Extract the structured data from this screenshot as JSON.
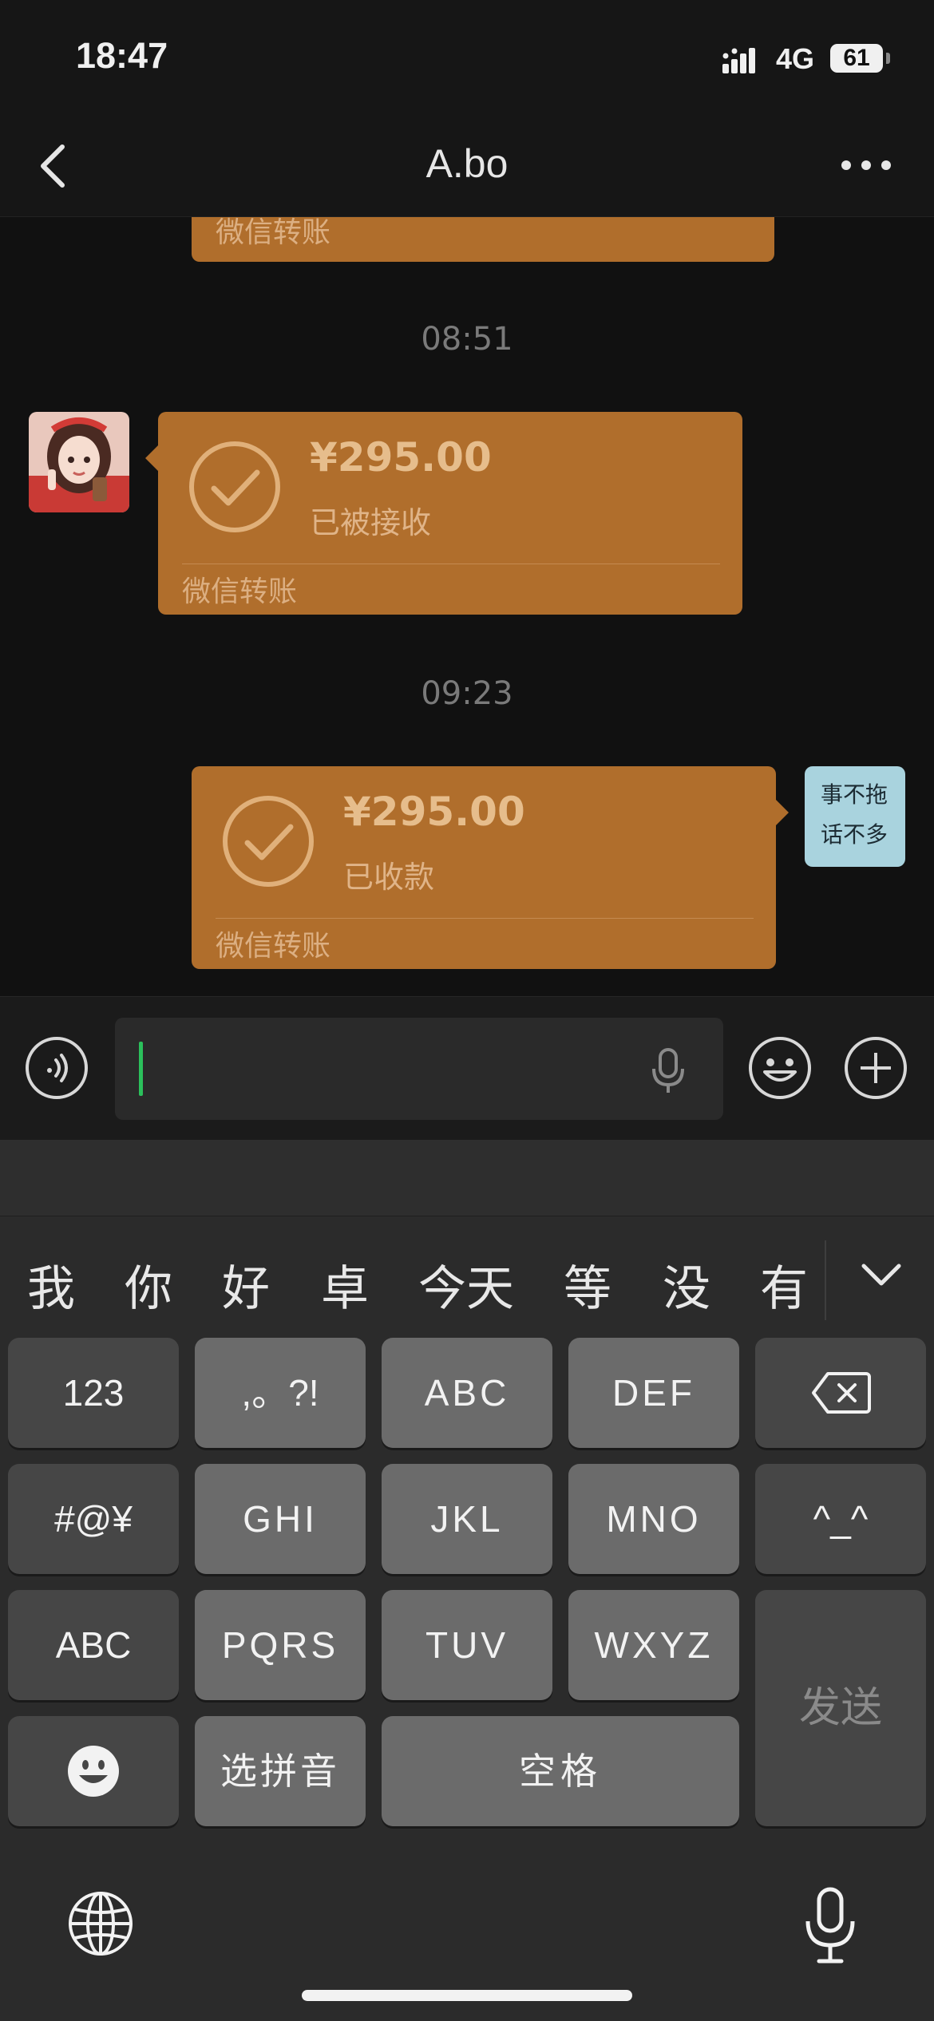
{
  "status_bar": {
    "time": "18:47",
    "network": "4G",
    "battery": "61"
  },
  "header": {
    "title": "A.bo"
  },
  "messages": [
    {
      "type": "transfer",
      "footer": "微信转账"
    },
    {
      "type": "timestamp",
      "text": "08:51"
    },
    {
      "type": "transfer",
      "sender": "contact",
      "amount": "¥295.00",
      "status": "已被接收",
      "footer": "微信转账"
    },
    {
      "type": "timestamp",
      "text": "09:23"
    },
    {
      "type": "transfer",
      "sender": "me",
      "amount": "¥295.00",
      "status": "已收款",
      "footer": "微信转账",
      "avatar_text": [
        "事不拖",
        "话不多"
      ]
    }
  ],
  "input": {
    "placeholder": ""
  },
  "keyboard": {
    "candidates": [
      "我",
      "你",
      "好",
      "卓",
      "今天",
      "等",
      "没",
      "有"
    ],
    "rows": [
      [
        "123",
        ",。?!",
        "ABC",
        "DEF"
      ],
      [
        "#@¥",
        "GHI",
        "JKL",
        "MNO",
        "^_^"
      ],
      [
        "ABC",
        "PQRS",
        "TUV",
        "WXYZ"
      ],
      [
        "选拼音",
        "空格"
      ]
    ],
    "send_label": "发送"
  },
  "colors": {
    "transfer_bubble": "#b06e2c",
    "caret": "#2bc05b",
    "background": "#111111"
  }
}
